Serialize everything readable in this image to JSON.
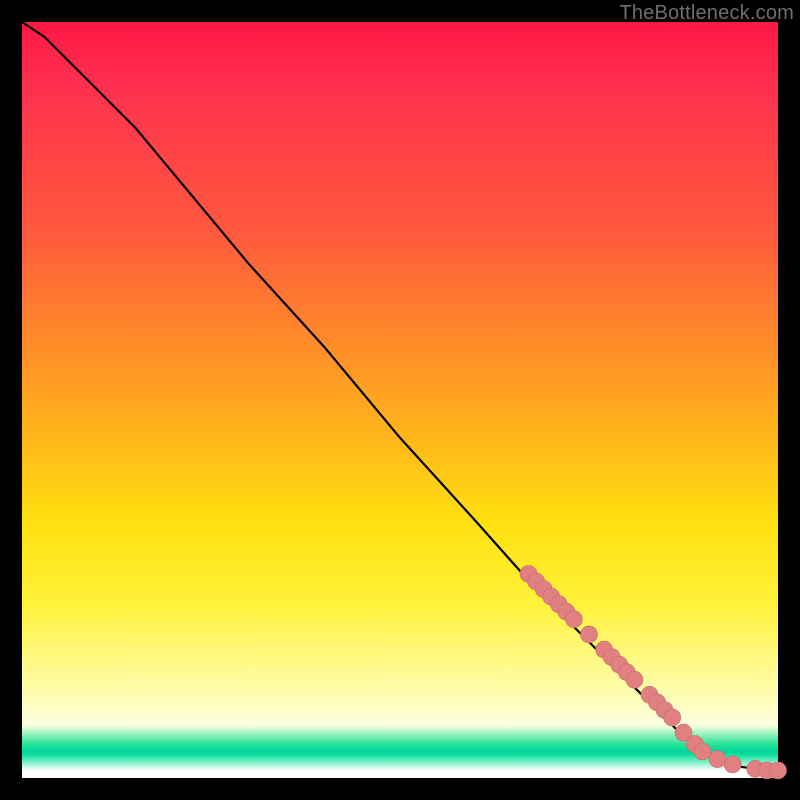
{
  "watermark": "TheBottleneck.com",
  "colors": {
    "frame": "#000000",
    "curve": "#000000",
    "marker_fill": "#e08080",
    "marker_stroke": "#c96b6b"
  },
  "chart_data": {
    "type": "line",
    "title": "",
    "xlabel": "",
    "ylabel": "",
    "xlim": [
      0,
      100
    ],
    "ylim": [
      0,
      100
    ],
    "grid": false,
    "series": [
      {
        "name": "curve",
        "x": [
          0,
          3,
          6,
          10,
          15,
          20,
          30,
          40,
          50,
          60,
          68,
          70,
          72,
          74,
          76,
          78,
          80,
          82,
          84,
          85,
          86,
          87,
          88,
          90,
          92,
          93,
          95,
          97,
          99,
          100
        ],
        "y": [
          100,
          98,
          95,
          91,
          86,
          80,
          68,
          57,
          45,
          34,
          25,
          23,
          21,
          19,
          17,
          15,
          13,
          11,
          9,
          8,
          7,
          6,
          5,
          3.5,
          2.5,
          2,
          1.5,
          1.2,
          1,
          1
        ]
      }
    ],
    "markers": [
      {
        "x": 67,
        "y": 27
      },
      {
        "x": 68,
        "y": 26
      },
      {
        "x": 69,
        "y": 25
      },
      {
        "x": 70,
        "y": 24
      },
      {
        "x": 71,
        "y": 23
      },
      {
        "x": 72,
        "y": 22
      },
      {
        "x": 73,
        "y": 21
      },
      {
        "x": 75,
        "y": 19
      },
      {
        "x": 77,
        "y": 17
      },
      {
        "x": 78,
        "y": 16
      },
      {
        "x": 79,
        "y": 15
      },
      {
        "x": 80,
        "y": 14
      },
      {
        "x": 81,
        "y": 13
      },
      {
        "x": 83,
        "y": 11
      },
      {
        "x": 84,
        "y": 10
      },
      {
        "x": 85,
        "y": 9
      },
      {
        "x": 86,
        "y": 8
      },
      {
        "x": 87.5,
        "y": 6
      },
      {
        "x": 89,
        "y": 4.5
      },
      {
        "x": 90,
        "y": 3.5
      },
      {
        "x": 92,
        "y": 2.5
      },
      {
        "x": 94,
        "y": 1.8
      },
      {
        "x": 97,
        "y": 1.2
      },
      {
        "x": 98.5,
        "y": 1
      },
      {
        "x": 100,
        "y": 1
      }
    ]
  }
}
